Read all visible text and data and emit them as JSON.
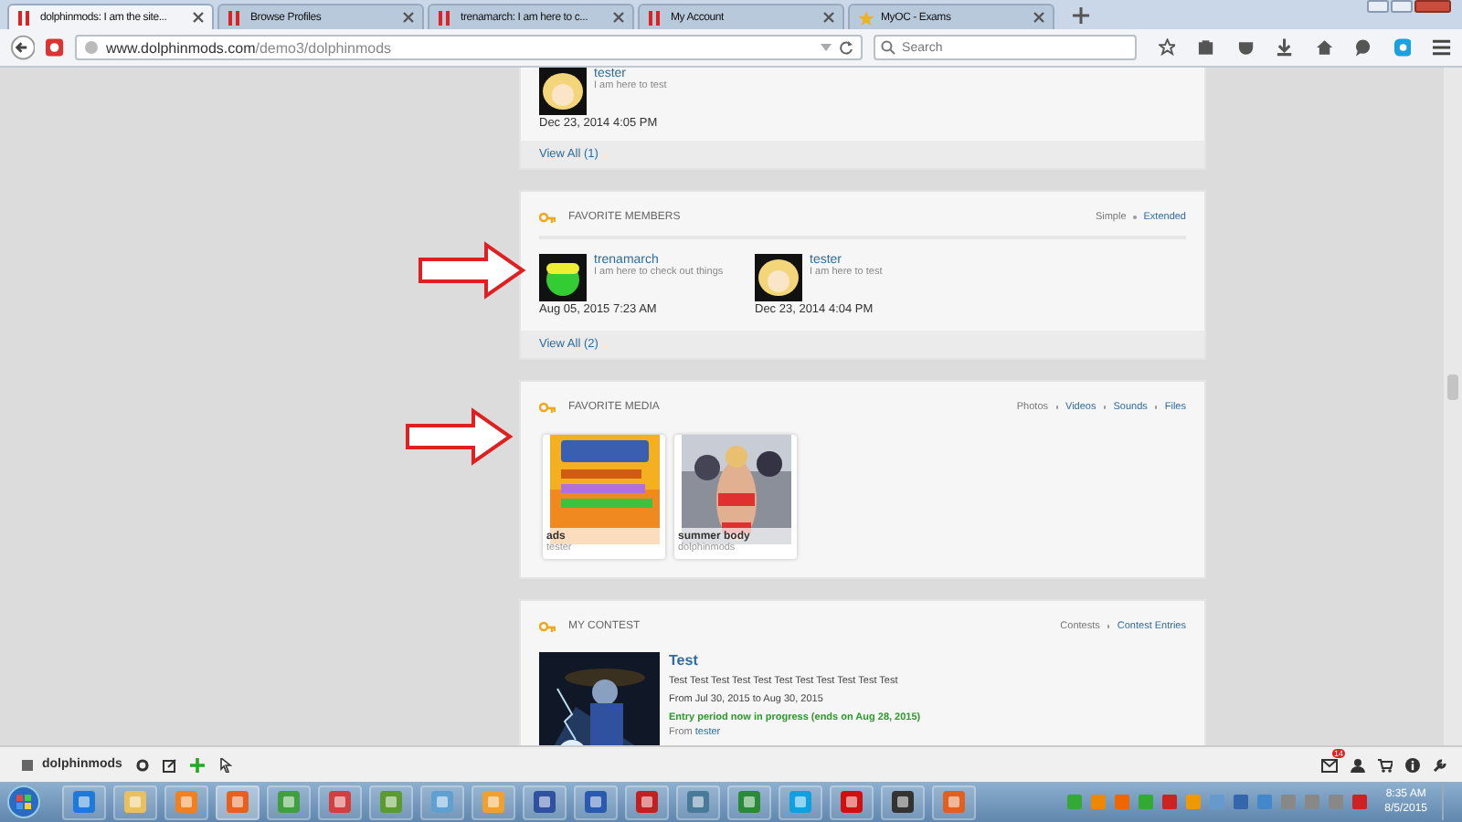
{
  "browser": {
    "tabs": [
      {
        "title": "dolphinmods: I am the site...",
        "selected": true
      },
      {
        "title": "Browse Profiles",
        "selected": false
      },
      {
        "title": "trenamarch: I am here to c...",
        "selected": false
      },
      {
        "title": "My Account",
        "selected": false
      },
      {
        "title": "MyOC - Exams",
        "selected": false
      }
    ],
    "url": {
      "domain": "www.dolphinmods.com",
      "path": "/demo3/dolphinmods"
    },
    "search": {
      "placeholder": "Search"
    }
  },
  "top_card": {
    "member": {
      "name": "tester",
      "status": "I am here to test",
      "date": "Dec 23, 2014 4:05 PM"
    },
    "footer": "View All (1)"
  },
  "favorite_members": {
    "title": "FAVORITE MEMBERS",
    "views": [
      {
        "label": "Simple",
        "selected": true
      },
      {
        "label": "Extended",
        "selected": false
      }
    ],
    "members": [
      {
        "name": "trenamarch",
        "status": "I am here to check out things",
        "date": "Aug 05, 2015 7:23 AM",
        "kind": "green"
      },
      {
        "name": "tester",
        "status": "I am here to test",
        "date": "Dec 23, 2014 4:04 PM",
        "kind": "blonde"
      }
    ],
    "footer": "View All (2)"
  },
  "favorite_media": {
    "title": "FAVORITE MEDIA",
    "filters": [
      {
        "label": "Photos",
        "selected": true
      },
      {
        "label": "Videos",
        "selected": false
      },
      {
        "label": "Sounds",
        "selected": false
      },
      {
        "label": "Files",
        "selected": false
      }
    ],
    "items": [
      {
        "title": "ads",
        "owner": "tester",
        "kind": "picture"
      },
      {
        "title": "summer body",
        "owner": "dolphinmods",
        "kind": "picture"
      }
    ]
  },
  "my_contest": {
    "title": "MY CONTEST",
    "links": [
      {
        "label": "Contests",
        "selected": true
      },
      {
        "label": "Contest Entries",
        "selected": false
      }
    ],
    "name": "Test",
    "description": "Test Test Test Test Test Test Test Test Test Test Test",
    "dates": "From Jul 30, 2015 to Aug 30, 2015",
    "status": "Entry period now in progress (ends on Aug 28, 2015)",
    "from_label": "From",
    "author": "tester"
  },
  "site_toolbar": {
    "site": "dolphinmods",
    "notification_count": "14"
  },
  "taskbar": {
    "time": "8:35 AM",
    "date": "8/5/2015"
  }
}
